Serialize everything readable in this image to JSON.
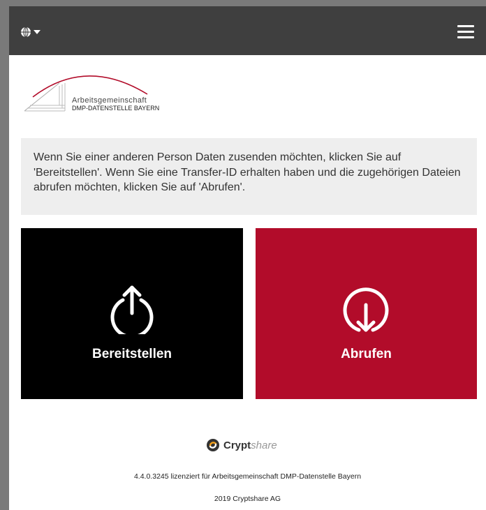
{
  "header": {
    "language_icon": "globe-icon",
    "dropdown_icon": "caret-down-icon",
    "menu_icon": "hamburger-menu-icon",
    "background_color": "#3f3f3f"
  },
  "logo": {
    "line1": "Arbeitsgemeinschaft",
    "line2": "DMP-DATENSTELLE BAYERN",
    "accent_color": "#b20c2a"
  },
  "info_text": "Wenn Sie einer anderen Person Daten zusenden möchten, klicken Sie auf 'Bereitstellen'. Wenn Sie eine Transfer-ID erhalten haben und die zugehörigen Dateien abrufen möchten, klicken Sie auf 'Abrufen'.",
  "tiles": {
    "upload": {
      "label": "Bereitstellen",
      "icon": "upload-arrow-icon",
      "color": "#000000"
    },
    "download": {
      "label": "Abrufen",
      "icon": "download-arrow-icon",
      "color": "#b20c2a"
    }
  },
  "footer": {
    "brand_bold": "Crypt",
    "brand_light": "share",
    "brand_icon": "cryptshare-logo-icon",
    "license": "4.4.0.3245 lizenziert für Arbeitsgemeinschaft DMP-Datenstelle Bayern",
    "copyright": "2019 Cryptshare AG"
  }
}
